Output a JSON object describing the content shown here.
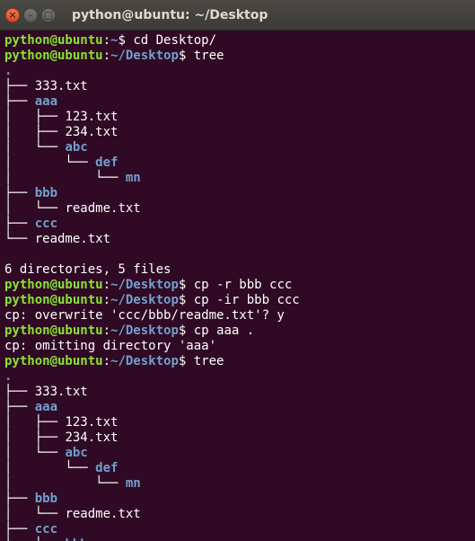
{
  "window": {
    "title": "python@ubuntu: ~/Desktop",
    "close_glyph": "×",
    "minimize_glyph": "–",
    "maximize_glyph": "□"
  },
  "terminal": {
    "lines": [
      {
        "t": "prompt",
        "user": "python@ubuntu",
        "colon": ":",
        "path": "~",
        "sym": "$ ",
        "cmd": "cd Desktop/"
      },
      {
        "t": "prompt",
        "user": "python@ubuntu",
        "colon": ":",
        "path": "~/Desktop",
        "sym": "$ ",
        "cmd": "tree"
      },
      {
        "t": "tree",
        "prefix": "",
        "name": ".",
        "kind": "dir"
      },
      {
        "t": "tree",
        "prefix": "├── ",
        "name": "333.txt",
        "kind": "file"
      },
      {
        "t": "tree",
        "prefix": "├── ",
        "name": "aaa",
        "kind": "dir"
      },
      {
        "t": "tree",
        "prefix": "│   ├── ",
        "name": "123.txt",
        "kind": "file"
      },
      {
        "t": "tree",
        "prefix": "│   ├── ",
        "name": "234.txt",
        "kind": "file"
      },
      {
        "t": "tree",
        "prefix": "│   └── ",
        "name": "abc",
        "kind": "dir"
      },
      {
        "t": "tree",
        "prefix": "│       └── ",
        "name": "def",
        "kind": "dir"
      },
      {
        "t": "tree",
        "prefix": "│           └── ",
        "name": "mn",
        "kind": "dir"
      },
      {
        "t": "tree",
        "prefix": "├── ",
        "name": "bbb",
        "kind": "dir"
      },
      {
        "t": "tree",
        "prefix": "│   └── ",
        "name": "readme.txt",
        "kind": "file"
      },
      {
        "t": "tree",
        "prefix": "├── ",
        "name": "ccc",
        "kind": "dir"
      },
      {
        "t": "tree",
        "prefix": "└── ",
        "name": "readme.txt",
        "kind": "file"
      },
      {
        "t": "text",
        "text": ""
      },
      {
        "t": "text",
        "text": "6 directories, 5 files"
      },
      {
        "t": "prompt",
        "user": "python@ubuntu",
        "colon": ":",
        "path": "~/Desktop",
        "sym": "$ ",
        "cmd": "cp -r bbb ccc"
      },
      {
        "t": "prompt",
        "user": "python@ubuntu",
        "colon": ":",
        "path": "~/Desktop",
        "sym": "$ ",
        "cmd": "cp -ir bbb ccc"
      },
      {
        "t": "text",
        "text": "cp: overwrite 'ccc/bbb/readme.txt'? y"
      },
      {
        "t": "prompt",
        "user": "python@ubuntu",
        "colon": ":",
        "path": "~/Desktop",
        "sym": "$ ",
        "cmd": "cp aaa ."
      },
      {
        "t": "text",
        "text": "cp: omitting directory 'aaa'"
      },
      {
        "t": "prompt",
        "user": "python@ubuntu",
        "colon": ":",
        "path": "~/Desktop",
        "sym": "$ ",
        "cmd": "tree"
      },
      {
        "t": "tree",
        "prefix": "",
        "name": ".",
        "kind": "dir"
      },
      {
        "t": "tree",
        "prefix": "├── ",
        "name": "333.txt",
        "kind": "file"
      },
      {
        "t": "tree",
        "prefix": "├── ",
        "name": "aaa",
        "kind": "dir"
      },
      {
        "t": "tree",
        "prefix": "│   ├── ",
        "name": "123.txt",
        "kind": "file"
      },
      {
        "t": "tree",
        "prefix": "│   ├── ",
        "name": "234.txt",
        "kind": "file"
      },
      {
        "t": "tree",
        "prefix": "│   └── ",
        "name": "abc",
        "kind": "dir"
      },
      {
        "t": "tree",
        "prefix": "│       └── ",
        "name": "def",
        "kind": "dir"
      },
      {
        "t": "tree",
        "prefix": "│           └── ",
        "name": "mn",
        "kind": "dir"
      },
      {
        "t": "tree",
        "prefix": "├── ",
        "name": "bbb",
        "kind": "dir"
      },
      {
        "t": "tree",
        "prefix": "│   └── ",
        "name": "readme.txt",
        "kind": "file"
      },
      {
        "t": "tree",
        "prefix": "├── ",
        "name": "ccc",
        "kind": "dir"
      },
      {
        "t": "tree",
        "prefix": "│   └── ",
        "name": "bbb",
        "kind": "dir"
      }
    ]
  },
  "colors": {
    "background": "#300a24",
    "prompt_user": "#8ae234",
    "prompt_path": "#729fcf",
    "directory": "#729fcf",
    "text": "#ffffff"
  }
}
